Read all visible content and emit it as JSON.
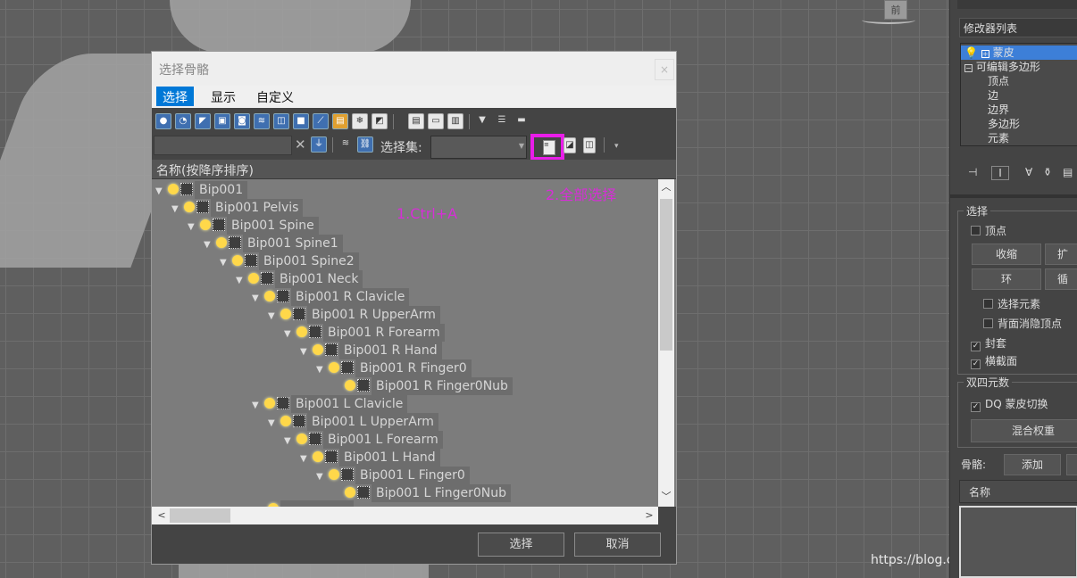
{
  "viewport": {
    "nav_cube_label": "前"
  },
  "watermark": "https://blog.csdn.net/lhe159324",
  "right_panel": {
    "modifier_list": "修改器列表",
    "stack": [
      "蒙皮",
      "可编辑多边形",
      "顶点",
      "边",
      "边界",
      "多边形",
      "元素"
    ],
    "select_group": "选择",
    "vertex_check": "顶点",
    "shrink": "收缩",
    "grow": "扩",
    "ring": "环",
    "loop": "循",
    "select_element": "选择元素",
    "backface": "背面消隐顶点",
    "envelope": "封套",
    "cross_section": "横截面",
    "dq_group": "双四元数",
    "dq_toggle": "DQ 蒙皮切换",
    "blend_weights": "混合权重",
    "bones_label": "骨骼:",
    "add": "添加",
    "name_header": "名称"
  },
  "dialog": {
    "title": "选择骨骼",
    "close": "×",
    "menus": [
      "选择",
      "显示",
      "自定义"
    ],
    "selection_set_label": "选择集:",
    "selection_set_value": "",
    "column_header": "名称(按降序排序)",
    "tree": [
      {
        "label": "Bip001",
        "level": 0
      },
      {
        "label": "Bip001 Pelvis",
        "level": 1
      },
      {
        "label": "Bip001 Spine",
        "level": 2
      },
      {
        "label": "Bip001 Spine1",
        "level": 3
      },
      {
        "label": "Bip001 Spine2",
        "level": 4
      },
      {
        "label": "Bip001 Neck",
        "level": 5
      },
      {
        "label": "Bip001 R Clavicle",
        "level": 6
      },
      {
        "label": "Bip001 R UpperArm",
        "level": 7
      },
      {
        "label": "Bip001 R Forearm",
        "level": 8
      },
      {
        "label": "Bip001 R Hand",
        "level": 9
      },
      {
        "label": "Bip001 R Finger0",
        "level": 10
      },
      {
        "label": "Bip001 R Finger0Nub",
        "level": 11,
        "leaf": true
      },
      {
        "label": "Bip001 L Clavicle",
        "level": 6
      },
      {
        "label": "Bip001 L UpperArm",
        "level": 7
      },
      {
        "label": "Bip001 L Forearm",
        "level": 8
      },
      {
        "label": "Bip001 L Hand",
        "level": 9
      },
      {
        "label": "Bip001 L Finger0",
        "level": 10
      },
      {
        "label": "Bip001 L Finger0Nub",
        "level": 11,
        "leaf": true
      }
    ],
    "annotation_1": "1.Ctrl+A",
    "annotation_2": "2.全部选择",
    "ok": "选择",
    "cancel": "取消"
  },
  "colors": {
    "highlight": "#e91de9",
    "annotation": "#d62fd6",
    "menu_active": "#0078d7"
  }
}
